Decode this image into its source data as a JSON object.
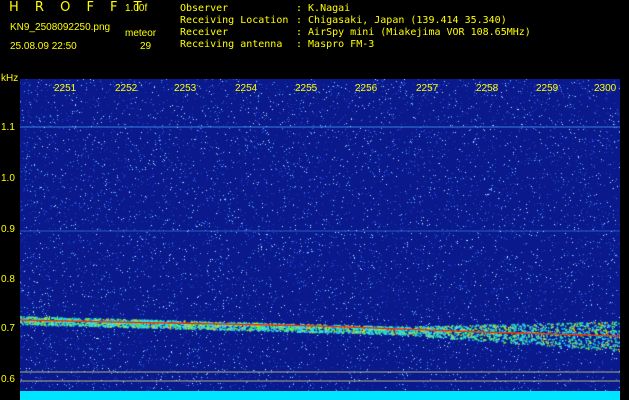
{
  "header": {
    "app_title": "H R O F F T",
    "version": "1.00f",
    "filename": "KN9_2508092250.png",
    "meteor_label": "meteor",
    "datetime": "25.08.09 22:50",
    "meteor_count": "29"
  },
  "info": [
    {
      "label": "Observer",
      "value": ": K.Nagai"
    },
    {
      "label": "Receiving Location",
      "value": ": Chigasaki, Japan (139.414 35.340)"
    },
    {
      "label": "Receiver",
      "value": ": AirSpy mini (Miakejima VOR 108.65MHz)"
    },
    {
      "label": "Receiving antenna",
      "value": ": Maspro FM-3"
    }
  ],
  "spectrogram": {
    "y_unit": "kHz",
    "y_ticks": [
      "1.1",
      "1.0",
      "0.9",
      "0.8",
      "0.7",
      "0.6"
    ],
    "x_ticks": [
      "2251",
      "2252",
      "2253",
      "2254",
      "2255",
      "2256",
      "2257",
      "2258",
      "2259",
      "2300"
    ],
    "colors": {
      "background": "#0a1a8c",
      "label": "#ffff00",
      "carrier": "#ff3300",
      "baseline": "#00e5ff"
    }
  }
}
